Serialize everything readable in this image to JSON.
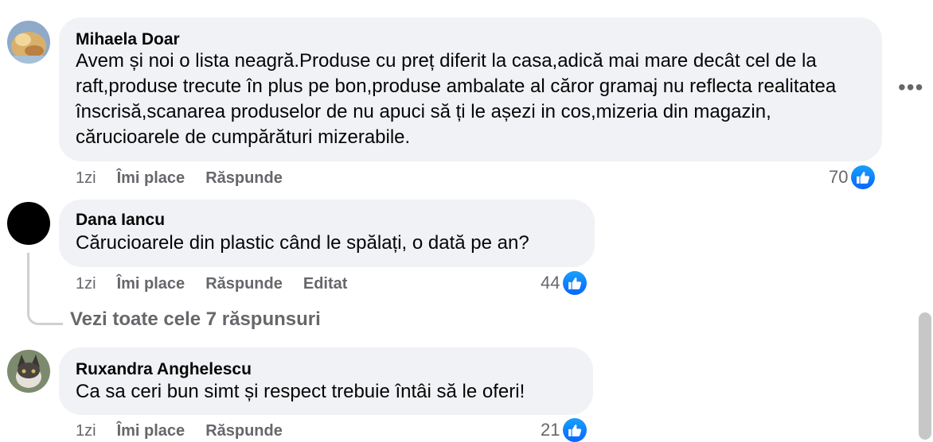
{
  "comments": [
    {
      "author": "Mihaela Doar",
      "text": "Avem și noi o lista neagră.Produse cu preț diferit la casa,adică mai mare decât cel de la raft,produse trecute în plus pe bon,produse ambalate al căror gramaj nu reflecta realitatea înscrisă,scanarea produselor de nu apuci să ți le așezi in cos,mizeria din magazin, cărucioarele de cumpărături mizerabile.",
      "time": "1zi",
      "like_label": "Îmi place",
      "reply_label": "Răspunde",
      "reaction_count": "70"
    },
    {
      "author": "Dana Iancu",
      "text": "Cărucioarele din plastic când le spălați, o dată pe an?",
      "time": "1zi",
      "like_label": "Îmi place",
      "reply_label": "Răspunde",
      "edited_label": "Editat",
      "reaction_count": "44"
    },
    {
      "author": "Ruxandra Anghelescu",
      "text": "Ca sa ceri bun simt și respect trebuie întâi să le oferi!",
      "time": "1zi",
      "like_label": "Îmi place",
      "reply_label": "Răspunde",
      "reaction_count": "21"
    }
  ],
  "see_all_replies": "Vezi toate cele 7 răspunsuri",
  "more_options": "•••",
  "icons": {
    "reaction": "thumbs-up-icon",
    "more": "more-options-icon"
  },
  "colors": {
    "bubble": "#f0f2f5",
    "like_blue": "#0866ff",
    "secondary_text": "#65676b"
  }
}
